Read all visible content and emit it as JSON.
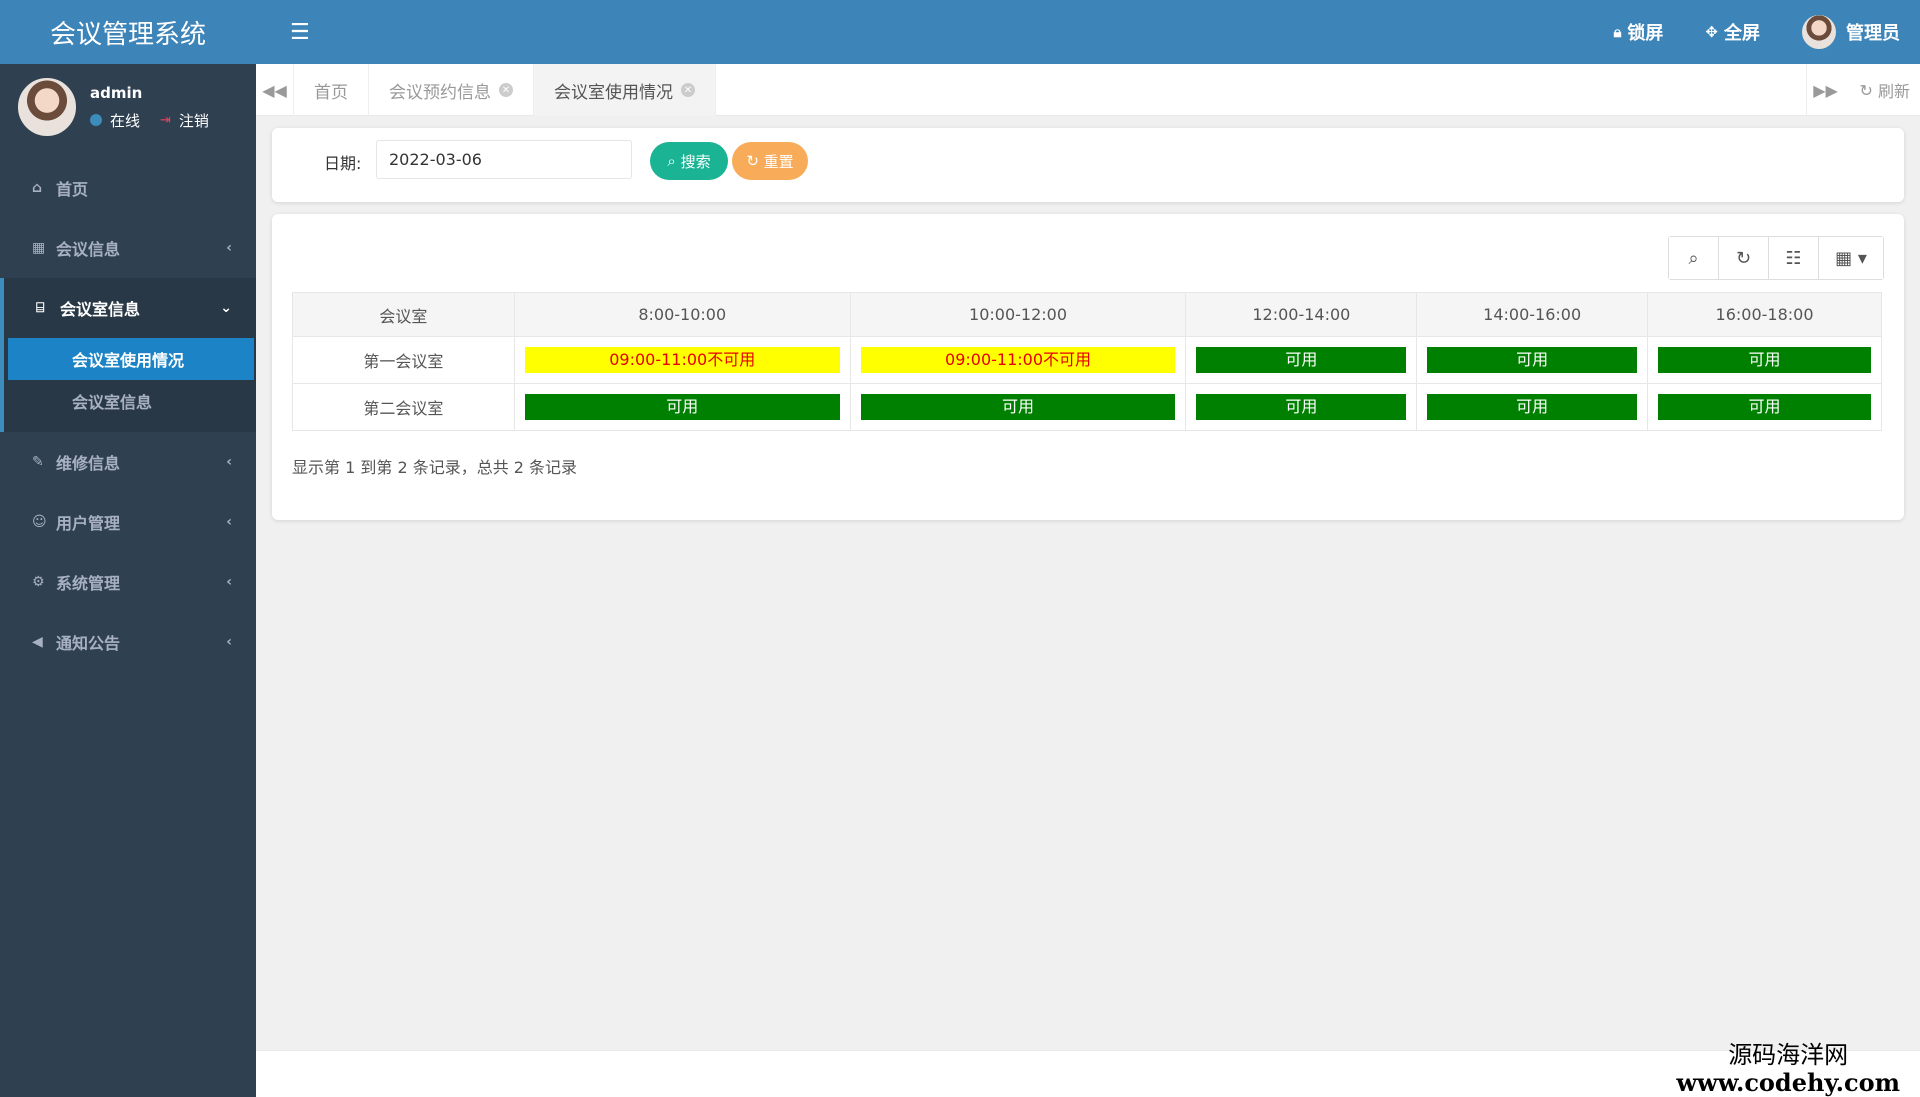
{
  "app": {
    "title": "会议管理系统"
  },
  "user": {
    "name": "admin",
    "status": "在线",
    "logout": "注销"
  },
  "topbar": {
    "lock": "锁屏",
    "fullscreen": "全屏",
    "admin": "管理员"
  },
  "menu": {
    "home": "首页",
    "meeting_info": "会议信息",
    "room_info": "会议室信息",
    "sub_room_usage": "会议室使用情况",
    "sub_room_info": "会议室信息",
    "repair": "维修信息",
    "users": "用户管理",
    "system": "系统管理",
    "notice": "通知公告"
  },
  "tabs": {
    "home": "首页",
    "booking": "会议预约信息",
    "usage": "会议室使用情况",
    "refresh": "刷新"
  },
  "search": {
    "date_label": "日期:",
    "date_value": "2022-03-06",
    "search_btn": "搜索",
    "reset_btn": "重置"
  },
  "table": {
    "headers": [
      "会议室",
      "8:00-10:00",
      "10:00-12:00",
      "12:00-14:00",
      "14:00-16:00",
      "16:00-18:00"
    ],
    "rows": [
      {
        "room": "第一会议室",
        "slots": [
          "09:00-11:00不可用",
          "09:00-11:00不可用",
          "可用",
          "可用",
          "可用"
        ]
      },
      {
        "room": "第二会议室",
        "slots": [
          "可用",
          "可用",
          "可用",
          "可用",
          "可用"
        ]
      }
    ],
    "summary": "显示第 1 到第 2 条记录，总共 2 条记录"
  },
  "watermark": {
    "title": "源码海洋网",
    "url": "www.codehy.com"
  },
  "colors": {
    "sidebar": "#2f4050",
    "topbar": "#3d84b8",
    "busy": "#ffff00",
    "busy_text": "#e60000",
    "free": "#008000",
    "search_btn": "#1ab394",
    "reset_btn": "#f8ac59"
  }
}
